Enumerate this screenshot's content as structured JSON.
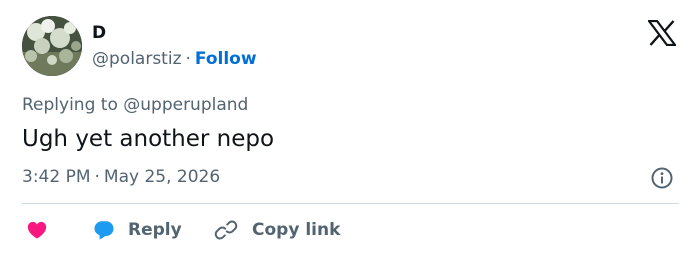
{
  "author": {
    "display_name": "D",
    "handle": "@polarstiz",
    "separator": "·",
    "follow_label": "Follow"
  },
  "tweet": {
    "replying_to_prefix": "Replying to",
    "replying_to_handle": "@upperupland",
    "text": "Ugh yet another nepo",
    "time": "3:42 PM",
    "separator": "·",
    "date": "May 25, 2026"
  },
  "actions": {
    "reply_label": "Reply",
    "copy_link_label": "Copy link"
  },
  "icons": {
    "logo": "x-logo-icon",
    "info": "info-icon",
    "like": "heart-icon",
    "reply": "speech-bubble-icon",
    "copy_link": "link-icon"
  },
  "colors": {
    "accent": "#006fd6",
    "secondary_text": "#536471",
    "primary_text": "#0f1419",
    "heart": "#f91880",
    "reply_bubble": "#1d9bf0",
    "divider": "#cfd9de"
  }
}
